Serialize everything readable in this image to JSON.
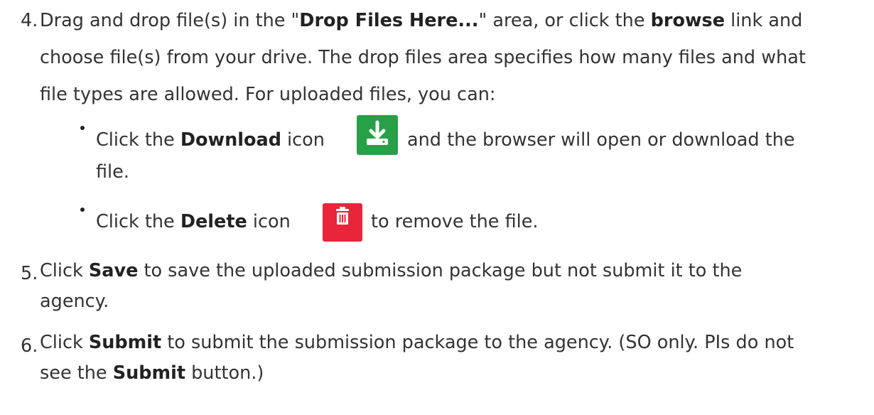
{
  "step4": {
    "number": "4.",
    "line1": {
      "t1": "Drag and drop file(s) in the \"",
      "b1": "Drop Files Here...",
      "t2": "\" area, or click the ",
      "b2": "browse",
      "t3": " link and"
    },
    "line2": "choose file(s) from your drive. The drop files area specifies how many files and what",
    "line3": "file types are allowed. For uploaded files, you can:",
    "bullet1": {
      "t1": "Click the ",
      "b1": "Download",
      "t2": " icon",
      "t3": "and the browser will open or download the",
      "t4": "file."
    },
    "bullet2": {
      "t1": "Click the ",
      "b1": "Delete",
      "t2": " icon",
      "t3": "to remove the file."
    }
  },
  "step5": {
    "number": "5.",
    "t1": "Click ",
    "b1": "Save",
    "t2": " to save the uploaded submission package but not submit it to the",
    "line2": "agency."
  },
  "step6": {
    "number": "6.",
    "t1": "Click ",
    "b1": "Submit",
    "t2": " to submit the submission package to the agency. (SO only. PIs do not",
    "l2a": "see the ",
    "l2b": "Submit",
    "l2c": " button.)"
  },
  "colors": {
    "text": "#333333",
    "download_icon_bg": "#27a047",
    "delete_icon_bg": "#e8253a"
  },
  "icons": {
    "download": "download-icon",
    "delete": "trash-icon"
  }
}
